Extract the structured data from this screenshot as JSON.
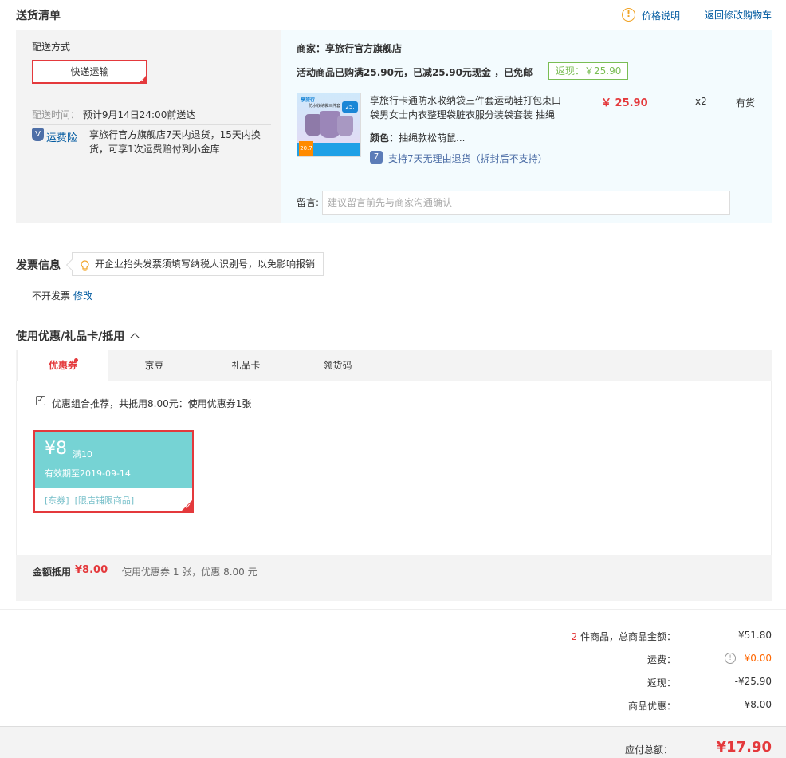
{
  "delivery": {
    "title": "送货清单",
    "price_note": "价格说明",
    "back_to_cart": "返回修改购物车",
    "method_label": "配送方式",
    "method_value": "快递运输",
    "time_label": "配送时间：",
    "time_value": "预计9月14日24:00前送达",
    "insurance_label": "运费险",
    "insurance_desc_1": "享旅行官方旗舰店7天内退货，15天内换",
    "insurance_desc_2": "货，可享1次运费赔付到小金库"
  },
  "merchant": {
    "name": "商家：享旅行官方旗舰店",
    "promo": "活动商品已购满25.90元，已减25.90元现金 ，已免邮",
    "rebate": "返现：￥25.90",
    "product": {
      "title_1": "享旅行卡通防水收纳袋三件套运动鞋打包束口",
      "title_2": "袋男女士内衣整理袋脏衣服分装袋套装 抽绳",
      "price": "￥ 25.90",
      "qty": "x2",
      "stock": "有货",
      "color_label": "颜色：",
      "color_value": "抽绳款松萌鼠...",
      "return_policy": "支持7天无理由退货（拆封后不支持）",
      "img_text_1": "享旅行",
      "img_text_2": "防水收纳袋三件套",
      "img_badge": "25.",
      "img_price": "20.7"
    },
    "message_label": "留言:",
    "message_placeholder": "建议留言前先与商家沟通确认"
  },
  "invoice": {
    "title": "发票信息",
    "tip": "开企业抬头发票须填写纳税人识别号，以免影响报销",
    "status": "不开发票",
    "edit": "修改"
  },
  "discount": {
    "title": "使用优惠/礼品卡/抵用",
    "tabs": [
      "优惠券",
      "京豆",
      "礼品卡",
      "领货码"
    ],
    "combo_text": "优惠组合推荐，共抵用8.00元：使用优惠券1张",
    "coupon": {
      "amount": "¥8",
      "condition": "满10",
      "expiry": "有效期至2019-09-14",
      "tags": "[东券]  [限店铺限商品]"
    },
    "summary_label": "金额抵用",
    "summary_amount": "¥8.00",
    "summary_desc": "使用优惠券 1 张，优惠 8.00 元"
  },
  "totals": {
    "item_count": "2",
    "items_label": " 件商品，总商品金额：",
    "items_value": "¥51.80",
    "shipping_label": "运费：",
    "shipping_value": "¥0.00",
    "rebate_label": "返现：",
    "rebate_value": "-¥25.90",
    "discount_label": "商品优惠：",
    "discount_value": "-¥8.00",
    "payable_label": "应付总额：",
    "payable_value": "¥17.90"
  }
}
